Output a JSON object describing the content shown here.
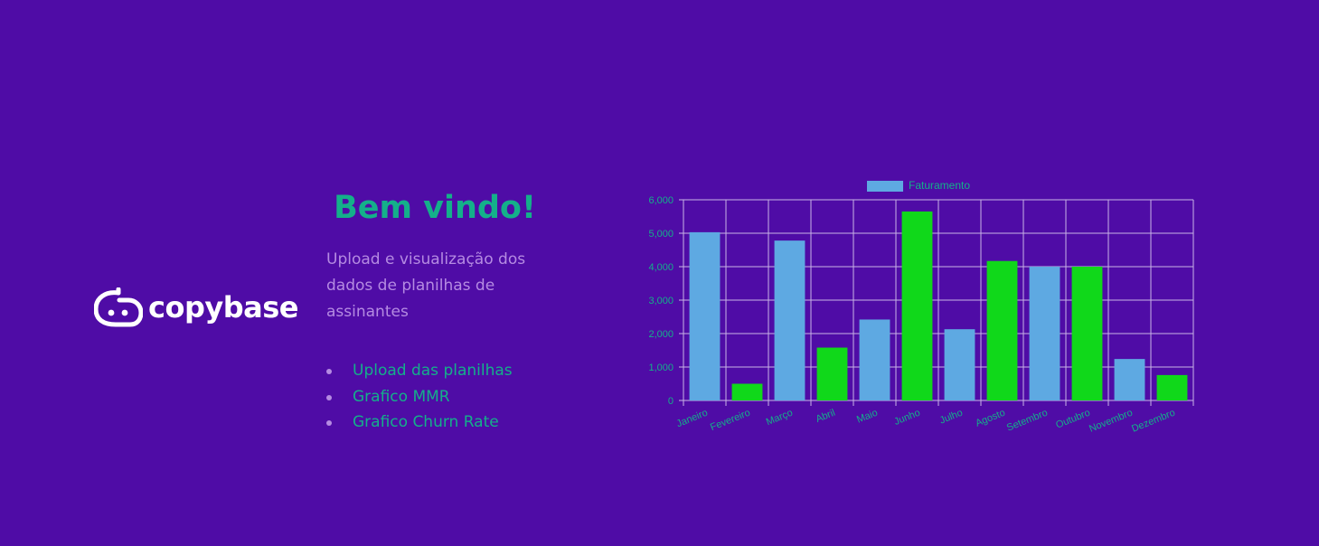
{
  "brand": {
    "name": "copybase"
  },
  "welcome": {
    "title": "Bem vindo!",
    "subtitle": "Upload e visualização dos dados de planilhas de assinantes",
    "links": [
      {
        "label": "Upload das planilhas"
      },
      {
        "label": "Grafico MMR"
      },
      {
        "label": "Grafico Churn Rate"
      }
    ]
  },
  "colors": {
    "background": "#4f0ca6",
    "accent": "#14b08a",
    "muted_text": "#b58be2",
    "bar_blue": "#5ea9e2",
    "bar_green": "#10d81a"
  },
  "chart_data": {
    "type": "bar",
    "legend": "Faturamento",
    "legend_position": "top",
    "categories": [
      "Janeiro",
      "Fevereiro",
      "Março",
      "Abril",
      "Maio",
      "Junho",
      "Julho",
      "Agosto",
      "Setembro",
      "Outubro",
      "Novembro",
      "Dezembro"
    ],
    "values": [
      5030,
      500,
      4780,
      1580,
      2420,
      5650,
      2130,
      4170,
      4000,
      4000,
      1240,
      760
    ],
    "bar_colors": [
      "#5ea9e2",
      "#10d81a",
      "#5ea9e2",
      "#10d81a",
      "#5ea9e2",
      "#10d81a",
      "#5ea9e2",
      "#10d81a",
      "#5ea9e2",
      "#10d81a",
      "#5ea9e2",
      "#10d81a"
    ],
    "yticks": [
      "0",
      "1,000",
      "2,000",
      "3,000",
      "4,000",
      "5,000",
      "6,000"
    ],
    "ylim": [
      0,
      6000
    ],
    "grid": true
  }
}
